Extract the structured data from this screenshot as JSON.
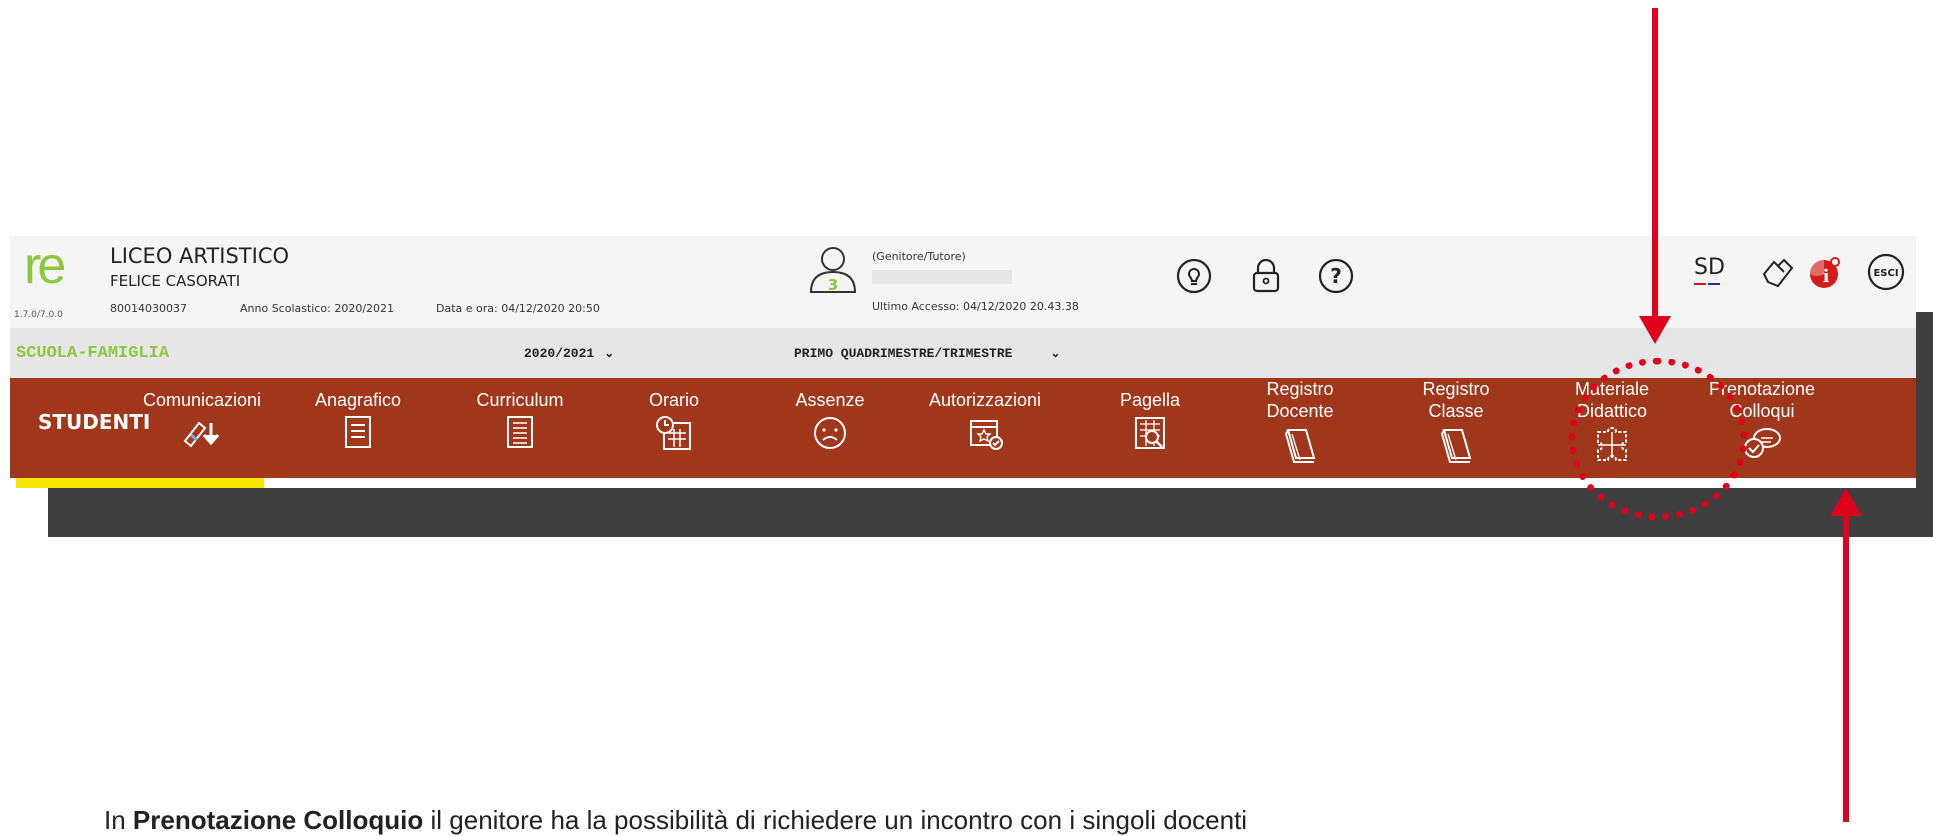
{
  "header": {
    "version": "1.7.0/7.0.0",
    "school_type": "LICEO ARTISTICO",
    "school_name": "FELICE CASORATI",
    "school_code": "80014030037",
    "school_year": "Anno Scolastico: 2020/2021",
    "datetime": "Data e ora: 04/12/2020 20:50",
    "user_role": "(Genitore/Tutore)",
    "last_access": "Ultimo Accesso: 04/12/2020 20.43.38",
    "avatar_badge": "3",
    "right_icons": [
      "lightbulb-icon",
      "lock-icon",
      "help-icon",
      "sd-icon",
      "hand-icon",
      "info-icon",
      "exit-icon"
    ],
    "sd_label": "SD",
    "exit_label": "ESCI"
  },
  "filterbar": {
    "section": "SCUOLA-FAMIGLIA",
    "year": "2020/2021",
    "period": "PRIMO QUADRIMESTRE/TRIMESTRE"
  },
  "nav": {
    "home": "STUDENTI",
    "items": [
      {
        "label": "Comunicazioni",
        "icon": "diploma-download-icon"
      },
      {
        "label": "Anagrafico",
        "icon": "document-icon"
      },
      {
        "label": "Curriculum",
        "icon": "document-list-icon"
      },
      {
        "label": "Orario",
        "icon": "calendar-clock-icon"
      },
      {
        "label": "Assenze",
        "icon": "sad-face-icon"
      },
      {
        "label": "Autorizzazioni",
        "icon": "calendar-check-icon"
      },
      {
        "label": "Pagella",
        "icon": "report-card-icon"
      },
      {
        "label": "Registro\nDocente",
        "icon": "book-icon"
      },
      {
        "label": "Registro\nClasse",
        "icon": "book-icon"
      },
      {
        "label": "Materiale\nDidattico",
        "icon": "puzzle-icon"
      },
      {
        "label": "Prenotazione\nColloqui",
        "icon": "speech-bubbles-icon"
      }
    ]
  },
  "caption": {
    "prefix": "In",
    "bold": "Prenotazione Colloquio",
    "rest": "il genitore ha la possibilità di richiedere un incontro con i singoli docenti"
  },
  "colors": {
    "brand_green": "#8dc63f",
    "nav_red": "#a0371b",
    "annotation_red": "#e0001b",
    "highlight_yellow": "#f5e600"
  }
}
